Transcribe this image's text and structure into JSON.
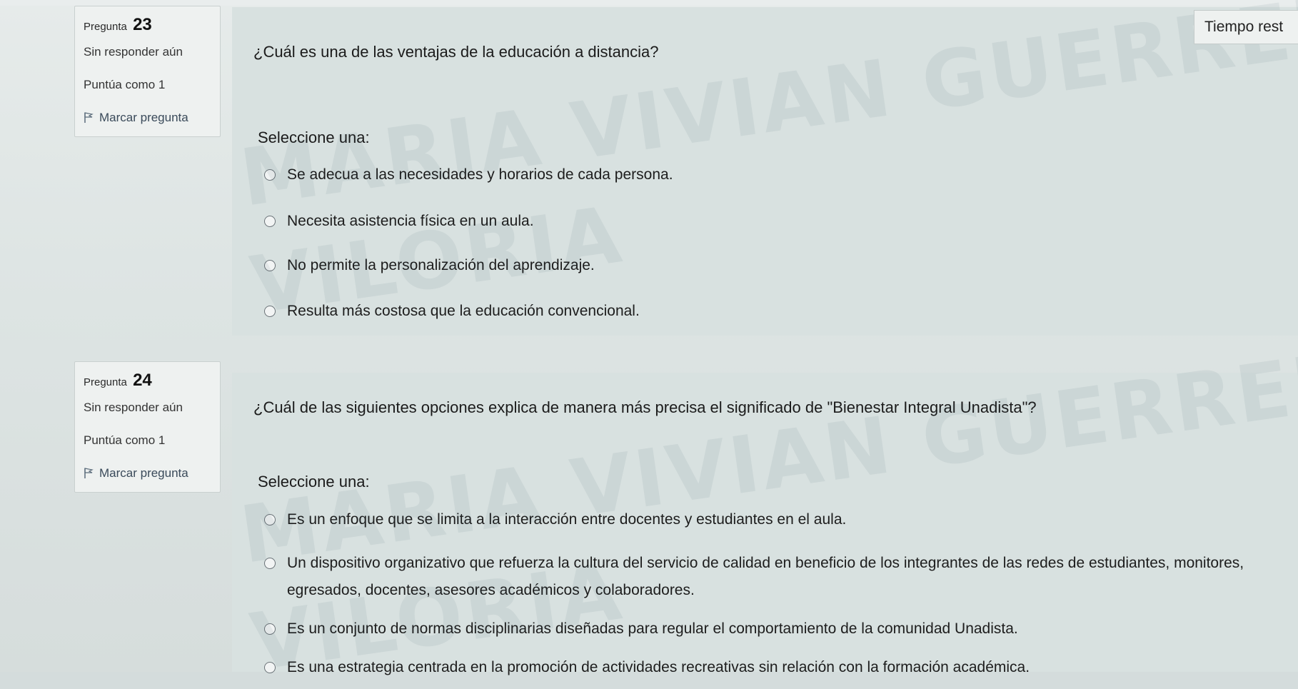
{
  "timer": {
    "label": "Tiempo rest"
  },
  "questions": [
    {
      "info": {
        "label": "Pregunta",
        "number": "23",
        "state": "Sin responder aún",
        "mark": "Puntúa como 1",
        "flag": "Marcar pregunta"
      },
      "text": "¿Cuál es una de las ventajas de la educación a distancia?",
      "prompt": "Seleccione una:",
      "answers": [
        "Se adecua a las necesidades y horarios de cada persona.",
        "Necesita asistencia física en un aula.",
        "No permite la personalización del aprendizaje.",
        "Resulta más costosa que la educación convencional."
      ]
    },
    {
      "info": {
        "label": "Pregunta",
        "number": "24",
        "state": "Sin responder aún",
        "mark": "Puntúa como 1",
        "flag": "Marcar pregunta"
      },
      "text": "¿Cuál de las siguientes opciones explica de manera más precisa el significado de \"Bienestar Integral Unadista\"?",
      "prompt": "Seleccione una:",
      "answers": [
        "Es un enfoque que se limita a la interacción entre docentes y estudiantes en el aula.",
        "Un dispositivo organizativo que refuerza la cultura del servicio de calidad en beneficio de los integrantes de las redes de estudiantes, monitores, egresados, docentes, asesores académicos y colaboradores.",
        "Es un conjunto de normas disciplinarias diseñadas para regular el comportamiento de la comunidad Unadista.",
        "Es una estrategia centrada en la promoción de actividades recreativas sin relación con la formación académica."
      ]
    }
  ],
  "watermark": {
    "line1": "MARIA VIVIAN GUERRERO",
    "line2": "VILORIA"
  }
}
